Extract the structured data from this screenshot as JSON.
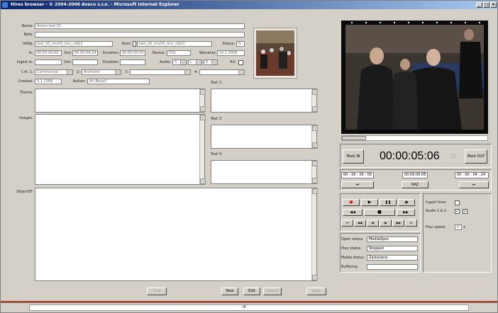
{
  "window": {
    "title": "Hires browser - © 2004-2006 Aveco s.r.o. - Microsoft Internet Explorer",
    "min": "_",
    "max": "□",
    "close": "×"
  },
  "form": {
    "name_label": "Name:",
    "name_value": "Aveco test 02",
    "note_label": "Note:",
    "note_value": "",
    "idobj_label": "IdObj:",
    "idobj_value": "test_02_imx50_imx_vid22",
    "root_label": "Root:",
    "root_value": "test_02_imx50_imx_vid22",
    "status_label": "Status:",
    "status_value": "N",
    "in_label": "In:",
    "in_value": "00:00:00:00",
    "out_label": "Out:",
    "out_value": "00:00:04:24",
    "duration_label": "Duration:",
    "duration_value": "00:00:05:00",
    "device_label": "Device:",
    "device_value": "DS1",
    "warranty_label": "Warranty:",
    "warranty_value": "10.1.2006",
    "ingestin_label": "Ingest In:",
    "ingestin_value": "",
    "out2_label": "Out:",
    "out2_value": "",
    "duration2_label": "Duration:",
    "duration2_value": "",
    "audio_label": "Audio:",
    "audio_sel1": "S",
    "audio_sel2": "L",
    "audio_sel3": "R",
    "rx_label": "RX:",
    "crit1_label": "Crit. 1:",
    "crit1_value": "Commercial",
    "crit2_label": "2:",
    "crit2_value": "Archived",
    "crit3_label": "3:",
    "crit3_value": "",
    "crit4_label": "4:",
    "crit4_value": "",
    "created_label": "Created:",
    "created_value": "5.1.2006",
    "author_label": "Author:",
    "author_value": "Ari Beuell",
    "theme_label": "Theme:",
    "images_label": "Images:",
    "objectsf_label": "ObjectSF:",
    "text1_label": "Text 1:",
    "text2_label": "Text 2:",
    "text3_label": "Text 3:"
  },
  "buttons": {
    "find": "Find",
    "new": "New",
    "edit": "Edit",
    "cancel": "Cancel",
    "save": "Save"
  },
  "player": {
    "mark_in": "Mark IN",
    "timecode": "00:00:05:06",
    "mark_out": "Mark OUT",
    "tc_in": "00 : 00 : 00 : 00",
    "tc_cur": "00:00:05:06",
    "tc_out": "00 : 00 : 04 : 24",
    "raz": "RAZ",
    "go_in": "⏮",
    "go_out": "⏭",
    "ingest_time_label": "Ingest time",
    "audio12_label": "Audio 1 & 2",
    "play_speed_label": "Play speed",
    "play_speed_value": "0",
    "play_speed_unit": "x",
    "open_status_label": "Open status",
    "open_status_value": "MediaOpen",
    "play_status_label": "Play status",
    "play_status_value": "Stopped",
    "media_status_label": "Media status",
    "media_status_value": "Zastaveno",
    "buffering_label": "Buffering",
    "buffering_value": ""
  },
  "transport": {
    "row1": [
      "●",
      "▶",
      "❚❚",
      "⏏"
    ],
    "row2": [
      "◀◀",
      "■",
      "▶▶"
    ],
    "row3": [
      "⏮",
      "◀◀|",
      "◀|",
      "|▶",
      "|▶▶",
      "⏭"
    ]
  },
  "statusbar": {
    "center": "III"
  },
  "colors": {
    "title_start": "#0a246a",
    "title_end": "#a6caf0",
    "record": "#e02020",
    "face": "#d4d0c8"
  }
}
